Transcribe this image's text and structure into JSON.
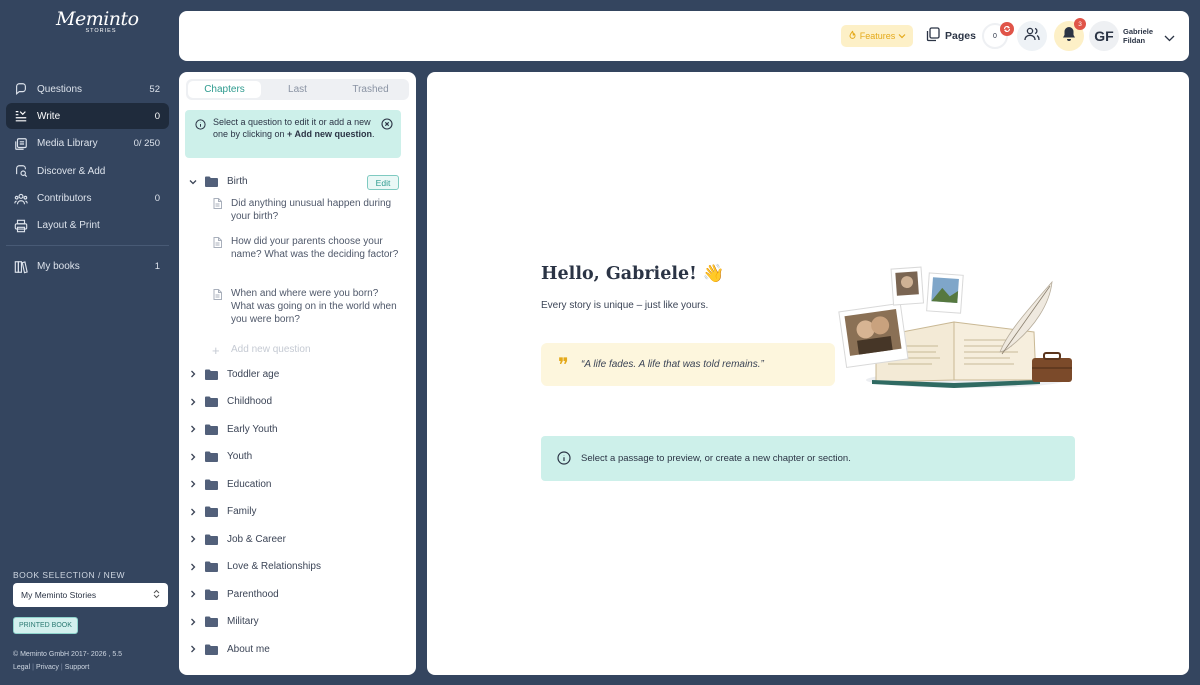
{
  "brand": {
    "name": "Meminto",
    "sub": "STORIES"
  },
  "nav": [
    {
      "label": "Questions",
      "count": "52",
      "icon": "chat-bubble-icon"
    },
    {
      "label": "Write",
      "count": "0",
      "icon": "write-lines-icon",
      "active": true
    },
    {
      "label": "Media Library",
      "count": "0/ 250",
      "icon": "media-library-icon"
    },
    {
      "label": "Discover & Add",
      "count": "",
      "icon": "discover-icon"
    },
    {
      "label": "Contributors",
      "count": "0",
      "icon": "contributors-icon"
    },
    {
      "label": "Layout & Print",
      "count": "",
      "icon": "printer-icon"
    },
    {
      "label": "My books",
      "count": "1",
      "icon": "books-icon"
    }
  ],
  "book_selection": {
    "title": "BOOK SELECTION / NEW",
    "selected": "My Meminto Stories",
    "badge": "PRINTED BOOK"
  },
  "footer": {
    "copyright": "© Meminto GmbH 2017- 2026 , 5.5",
    "links": [
      "Legal",
      "Privacy",
      "Support"
    ]
  },
  "topbar": {
    "features_label": "Features",
    "pages_label": "Pages",
    "pages_count": "0",
    "notification_count": "3",
    "avatar_initials": "GF",
    "user_first": "Gabriele",
    "user_last": "Fildan"
  },
  "chapters_panel": {
    "tabs": [
      "Chapters",
      "Last",
      "Trashed"
    ],
    "active_tab": "Chapters",
    "hint_part1": "Select a question to edit it or add a new one by clicking on ",
    "hint_bold": "+ Add new question",
    "hint_end": ".",
    "expanded_chapter": "Birth",
    "edit_label": "Edit",
    "questions": [
      "Did anything unusual happen during your birth?",
      "How did your parents choose your name? What was the deciding factor?",
      "When and where were you born? What was going on in the world when you were born?"
    ],
    "add_question_label": "Add new question",
    "chapters": [
      "Toddler age",
      "Childhood",
      "Early Youth",
      "Youth",
      "Education",
      "Family",
      "Job & Career",
      "Love & Relationships",
      "Parenthood",
      "Military",
      "About me"
    ]
  },
  "main": {
    "greeting": "Hello, Gabriele! 👋",
    "subtitle": "Every story is unique – just like yours.",
    "quote": "“A life fades. A life that was told remains.”",
    "preview_hint": "Select a passage to preview, or create a new chapter or section."
  },
  "colors": {
    "sidebar_bg": "#34455f",
    "accent_teal": "#2e9b8f",
    "hint_bg": "#cdf0ea",
    "quote_bg": "#fdf6dd",
    "badge_red": "#e05448",
    "features_yellow": "#e4a91a"
  }
}
